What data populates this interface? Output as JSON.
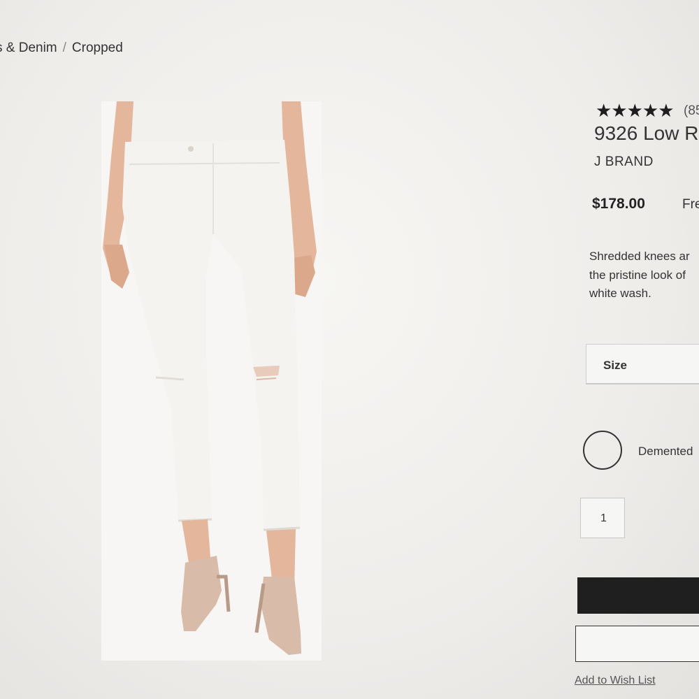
{
  "breadcrumb": {
    "prefix": "s & Denim",
    "separator": "/",
    "current": "Cropped"
  },
  "product": {
    "rating_stars": "★★★★★",
    "review_count": "(85",
    "title": "9326 Low R",
    "brand": "J BRAND",
    "price": "$178.00",
    "shipping": "Fre",
    "description": [
      "Shredded knees ar",
      "the pristine look of",
      "white wash."
    ],
    "size_label": "Size",
    "color_name": "Demented",
    "quantity": "1",
    "wishlist_link": "Add to Wish List"
  },
  "icons": {
    "swatch": "color-swatch-circle",
    "stars": "rating-stars-icon"
  },
  "colors": {
    "button_dark": "#1f1f1f",
    "jeans": "#f4f3ef",
    "shoes": "#d8bba8"
  }
}
